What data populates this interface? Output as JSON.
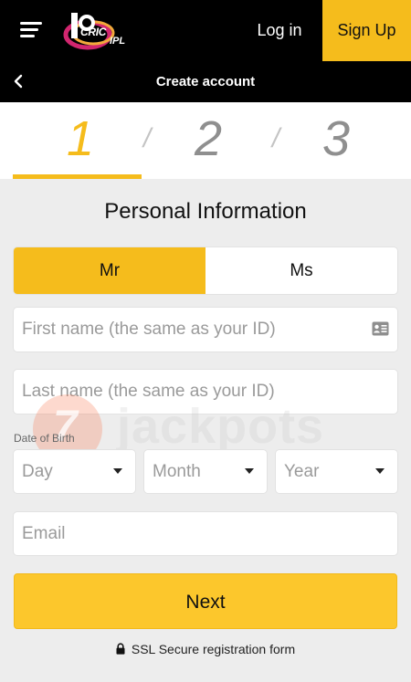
{
  "header": {
    "logo_text_top": "CRIC",
    "logo_text_bottom": "IPL",
    "login_label": "Log in",
    "signup_label": "Sign Up",
    "menu_icon": "hamburger-menu-icon"
  },
  "subheader": {
    "title": "Create account",
    "back_icon": "chevron-left-icon"
  },
  "steps": {
    "items": [
      "1",
      "2",
      "3"
    ],
    "separator": "/",
    "active_index": 0
  },
  "form": {
    "section_title": "Personal Information",
    "title_options": [
      "Mr",
      "Ms"
    ],
    "selected_title": "Mr",
    "first_name_placeholder": "First name (the same as your ID)",
    "first_name_icon": "id-card-icon",
    "last_name_placeholder": "Last name (the same as your ID)",
    "dob_label": "Date of Birth",
    "day_placeholder": "Day",
    "month_placeholder": "Month",
    "year_placeholder": "Year",
    "email_placeholder": "Email",
    "next_label": "Next",
    "ssl_text": "SSL Secure registration form"
  },
  "watermark": {
    "text": "jackpots",
    "badge": "7"
  },
  "colors": {
    "accent": "#f5bc1c",
    "header_bg": "#000000",
    "page_bg": "#ededed",
    "inactive_step": "#8f8f8f"
  }
}
